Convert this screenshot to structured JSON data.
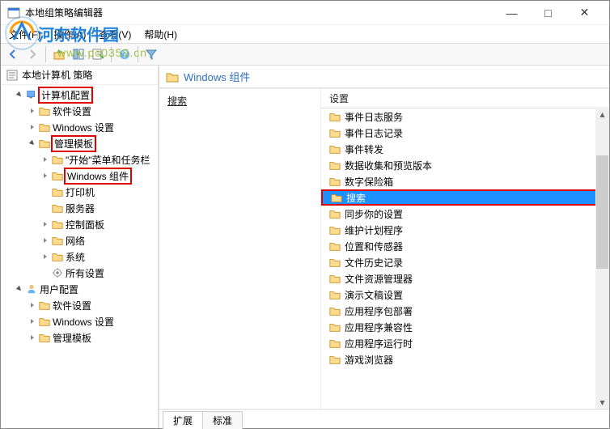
{
  "window": {
    "title": "本地组策略编辑器",
    "minimize": "—",
    "maximize": "□",
    "close": "✕"
  },
  "menu": {
    "file": "文件(F)",
    "action": "操作(A)",
    "view": "查看(V)",
    "help": "帮助(H)"
  },
  "watermark": {
    "text": "河东软件园",
    "url": "www.pc0359.cn"
  },
  "tree": {
    "root": "本地计算机 策略",
    "computer_config": "计算机配置",
    "software_settings": "软件设置",
    "windows_settings": "Windows 设置",
    "admin_templates": "管理模板",
    "start_menu": "\"开始\"菜单和任务栏",
    "windows_components": "Windows 组件",
    "printers": "打印机",
    "servers": "服务器",
    "control_panel": "控制面板",
    "network": "网络",
    "system": "系统",
    "all_settings": "所有设置",
    "user_config": "用户配置",
    "software_settings2": "软件设置",
    "windows_settings2": "Windows 设置",
    "admin_templates2": "管理模板"
  },
  "right": {
    "header": "Windows 组件",
    "leftcol_heading": "搜索",
    "list_heading": "设置",
    "items": [
      "事件日志服务",
      "事件日志记录",
      "事件转发",
      "数据收集和预览版本",
      "数字保险箱",
      "搜索",
      "同步你的设置",
      "维护计划程序",
      "位置和传感器",
      "文件历史记录",
      "文件资源管理器",
      "演示文稿设置",
      "应用程序包部署",
      "应用程序兼容性",
      "应用程序运行时",
      "游戏浏览器"
    ],
    "selected_index": 5
  },
  "tabs": {
    "extended": "扩展",
    "standard": "标准"
  }
}
